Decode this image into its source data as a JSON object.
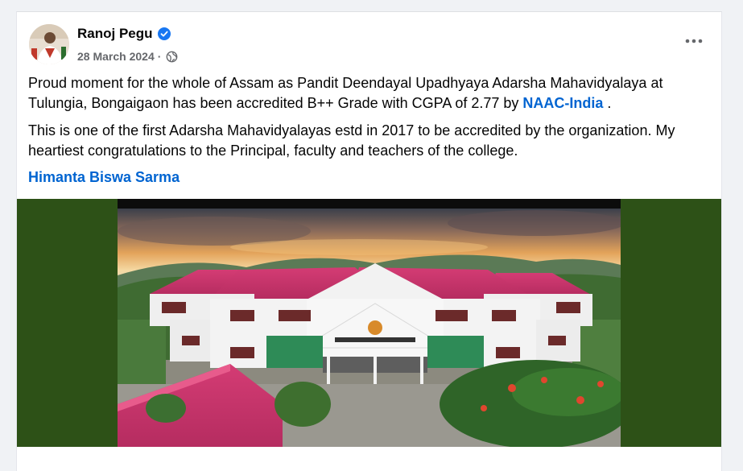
{
  "post": {
    "author": "Ranoj Pegu",
    "date": "28 March 2024",
    "separator": "·",
    "paragraph1_text": "Proud moment for the whole of Assam as Pandit Deendayal Upadhyaya Adarsha Mahavidyalaya at Tulungia, Bongaigaon has been accredited B++ Grade with CGPA of 2.77 by ",
    "paragraph1_link": "NAAC-India",
    "paragraph1_end": " .",
    "paragraph2": "This is one of the first Adarsha Mahavidyalayas estd in 2017 to be accredited by the organization. My heartiest congratulations to the Principal, faculty and teachers of the college.",
    "mention": "Himanta Biswa Sarma"
  },
  "icons": {
    "verified": "verified-badge-icon",
    "audience": "globe-icon",
    "more": "more-options-icon"
  },
  "colors": {
    "link": "#0064d1",
    "verified": "#1877f2",
    "media_background": "#2d5117",
    "roof": "#c8336b"
  }
}
